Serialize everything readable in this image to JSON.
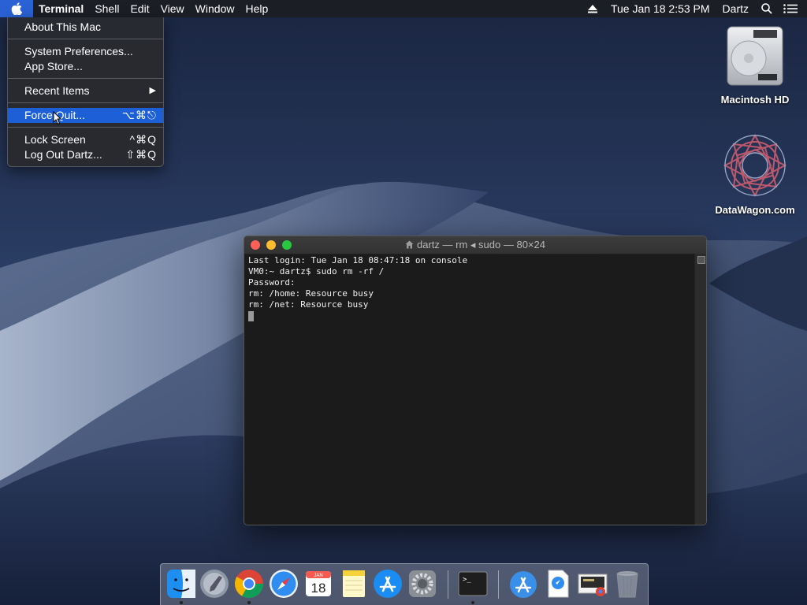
{
  "menubar": {
    "app_name": "Terminal",
    "menus": [
      "Shell",
      "Edit",
      "View",
      "Window",
      "Help"
    ],
    "datetime": "Tue Jan 18  2:53 PM",
    "user": "Dartz",
    "status_icons": [
      "eject-icon",
      "search-icon",
      "notification-center-icon"
    ]
  },
  "apple_menu": {
    "items": [
      {
        "label": "About This Mac",
        "shortcut": ""
      },
      {
        "label": "System Preferences...",
        "shortcut": ""
      },
      {
        "label": "App Store...",
        "shortcut": ""
      },
      {
        "label": "Recent Items",
        "shortcut": "▶"
      },
      {
        "label": "Force Quit...",
        "shortcut": "⌥⌘⎋",
        "highlighted": true
      },
      {
        "label": "Lock Screen",
        "shortcut": "^⌘Q"
      },
      {
        "label": "Log Out Dartz...",
        "shortcut": "⇧⌘Q"
      }
    ]
  },
  "desktop": {
    "icons": [
      {
        "label": "Macintosh HD",
        "icon": "hard-drive-icon"
      },
      {
        "label": "DataWagon.com",
        "icon": "datawagon-logo-icon"
      }
    ]
  },
  "terminal": {
    "title": "dartz — rm ◂ sudo — 80×24",
    "lines": [
      "Last login: Tue Jan 18 08:47:18 on console",
      "VM0:~ dartz$ sudo rm -rf /",
      "Password:",
      "rm: /home: Resource busy",
      "rm: /net: Resource busy"
    ]
  },
  "dock": {
    "apps": [
      {
        "name": "finder-icon",
        "running": true
      },
      {
        "name": "launchpad-icon",
        "running": false
      },
      {
        "name": "chrome-icon",
        "running": true
      },
      {
        "name": "safari-icon",
        "running": false
      },
      {
        "name": "calendar-icon",
        "running": false,
        "month": "JAN",
        "day": "18"
      },
      {
        "name": "notes-icon",
        "running": false
      },
      {
        "name": "app-store-icon",
        "running": false
      },
      {
        "name": "system-preferences-icon",
        "running": false
      },
      {
        "name": "terminal-icon",
        "running": true
      },
      {
        "name": "applications-folder-icon",
        "running": false
      },
      {
        "name": "downloads-icon",
        "running": false
      },
      {
        "name": "screenshot-file-icon",
        "running": false
      },
      {
        "name": "trash-icon",
        "running": false
      }
    ]
  },
  "colors": {
    "menu_highlight": "#1c5fd6",
    "terminal_bg": "#1b1b1b",
    "close": "#fe5f57",
    "minimize": "#febc2e",
    "zoom": "#28c840"
  }
}
